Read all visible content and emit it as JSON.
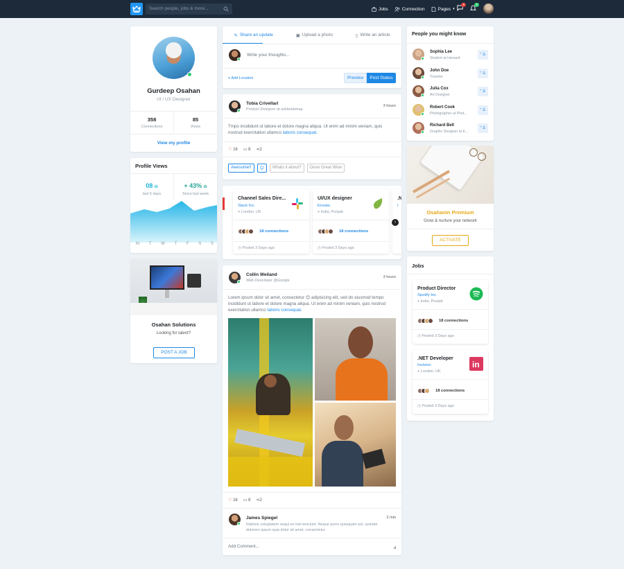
{
  "header": {
    "search_placeholder": "Search people, jobs & more...",
    "links": [
      "Jobs",
      "Connection",
      "Pages"
    ],
    "messages_badge": "8",
    "notifications_badge": "6"
  },
  "profile": {
    "name": "Gurdeep Osahan",
    "title": "UI / UX Designer",
    "connections_count": "358",
    "connections_label": "Connections",
    "views_count": "85",
    "views_label": "Views",
    "link": "View my profile"
  },
  "profile_views": {
    "title": "Profile Views",
    "stat1_value": "08",
    "stat1_label": "last 5 days",
    "stat2_value": "+ 43%",
    "stat2_label": "Since last week",
    "days": [
      "M",
      "T",
      "W",
      "T",
      "F",
      "S",
      "S"
    ]
  },
  "promo": {
    "name": "Osahan Solutions",
    "subtitle": "Looking for talent?",
    "button": "POST A JOB"
  },
  "composer": {
    "tabs": [
      "Share an update",
      "Upload a photo",
      "Write an article"
    ],
    "placeholder": "Write your thoughts...",
    "location": "Add Location",
    "preview": "Preview",
    "post": "Post Status"
  },
  "post1": {
    "author": "Tobia Crivellari",
    "role": "Product Designer at askbootstrap",
    "time": "3 hours",
    "text": "Tmpo incididunt ut labore et dolore magna aliqua. Ut enim ad minim veniam, quis nostrud exercitation ullamco",
    "link": "laboris consequat.",
    "likes": "16",
    "comments": "8",
    "shares": "2",
    "reactions": [
      "Awesome!!",
      "😊",
      "Whats it about?",
      "Oooo Great Wow"
    ]
  },
  "job_carousel": [
    {
      "title": "Channel Sales Dire...",
      "company": "Slack Inc.",
      "location": "London, UK",
      "connections": "18 connections",
      "posted": "Posted 3 Days ago"
    },
    {
      "title": "UI/UX designer",
      "company": "Envato",
      "location": "India, Punjab",
      "connections": "18 connections",
      "posted": "Posted 3 Days ago"
    },
    {
      "title": ".N",
      "company": "I",
      "location": "",
      "connections": "",
      "posted": ""
    }
  ],
  "post2": {
    "author": "Collin Weiland",
    "role": "Web Developer @Google",
    "time": "3 hours",
    "text": "Lorem ipsum dolor sit amet, consectetur 😊 adipisicing elit, sed do eiusmod tempo incididunt ut labore et dolore magna aliqua. Ut enim ad minim veniam, quis nostrud exercitation ullamco",
    "link": "laboris consequat.",
    "likes": "16",
    "comments": "8",
    "shares": "2"
  },
  "comment": {
    "author": "James Spiegel",
    "time": "2 min",
    "text": "Ratione voluptatem sequi en lod nesciunt. Neque porro quisquam est, quinder dolorem ipsum quia dolor sit amet, consectetur",
    "placeholder": "Add Comment..."
  },
  "people": {
    "title": "People you might know",
    "items": [
      {
        "name": "Sophia Lee",
        "role": "Student at Harvard"
      },
      {
        "name": "John Doe",
        "role": "Traveler"
      },
      {
        "name": "Julia Cox",
        "role": "Art Designer"
      },
      {
        "name": "Robert Cook",
        "role": "Photographer at Phot..."
      },
      {
        "name": "Richard Bell",
        "role": "Graphic Designer at E..."
      }
    ]
  },
  "premium": {
    "title": "Osahanin Premium",
    "subtitle": "Grow & nurture your network",
    "button": "ACTIVATE"
  },
  "jobs": {
    "title": "Jobs",
    "items": [
      {
        "title": "Product Director",
        "company": "Spotify Inc.",
        "location": "India, Punjab",
        "connections": "18 connections",
        "posted": "Posted 3 Days ago"
      },
      {
        "title": ".NET Developer",
        "company": "Invision",
        "location": "London, UK",
        "connections": "18 connections",
        "posted": "Posted 3 Days ago"
      }
    ]
  },
  "colors": {
    "accent": "#1e88e5",
    "nav": "#1c2a3a",
    "premium": "#e6a817",
    "green": "#2ecc71"
  }
}
